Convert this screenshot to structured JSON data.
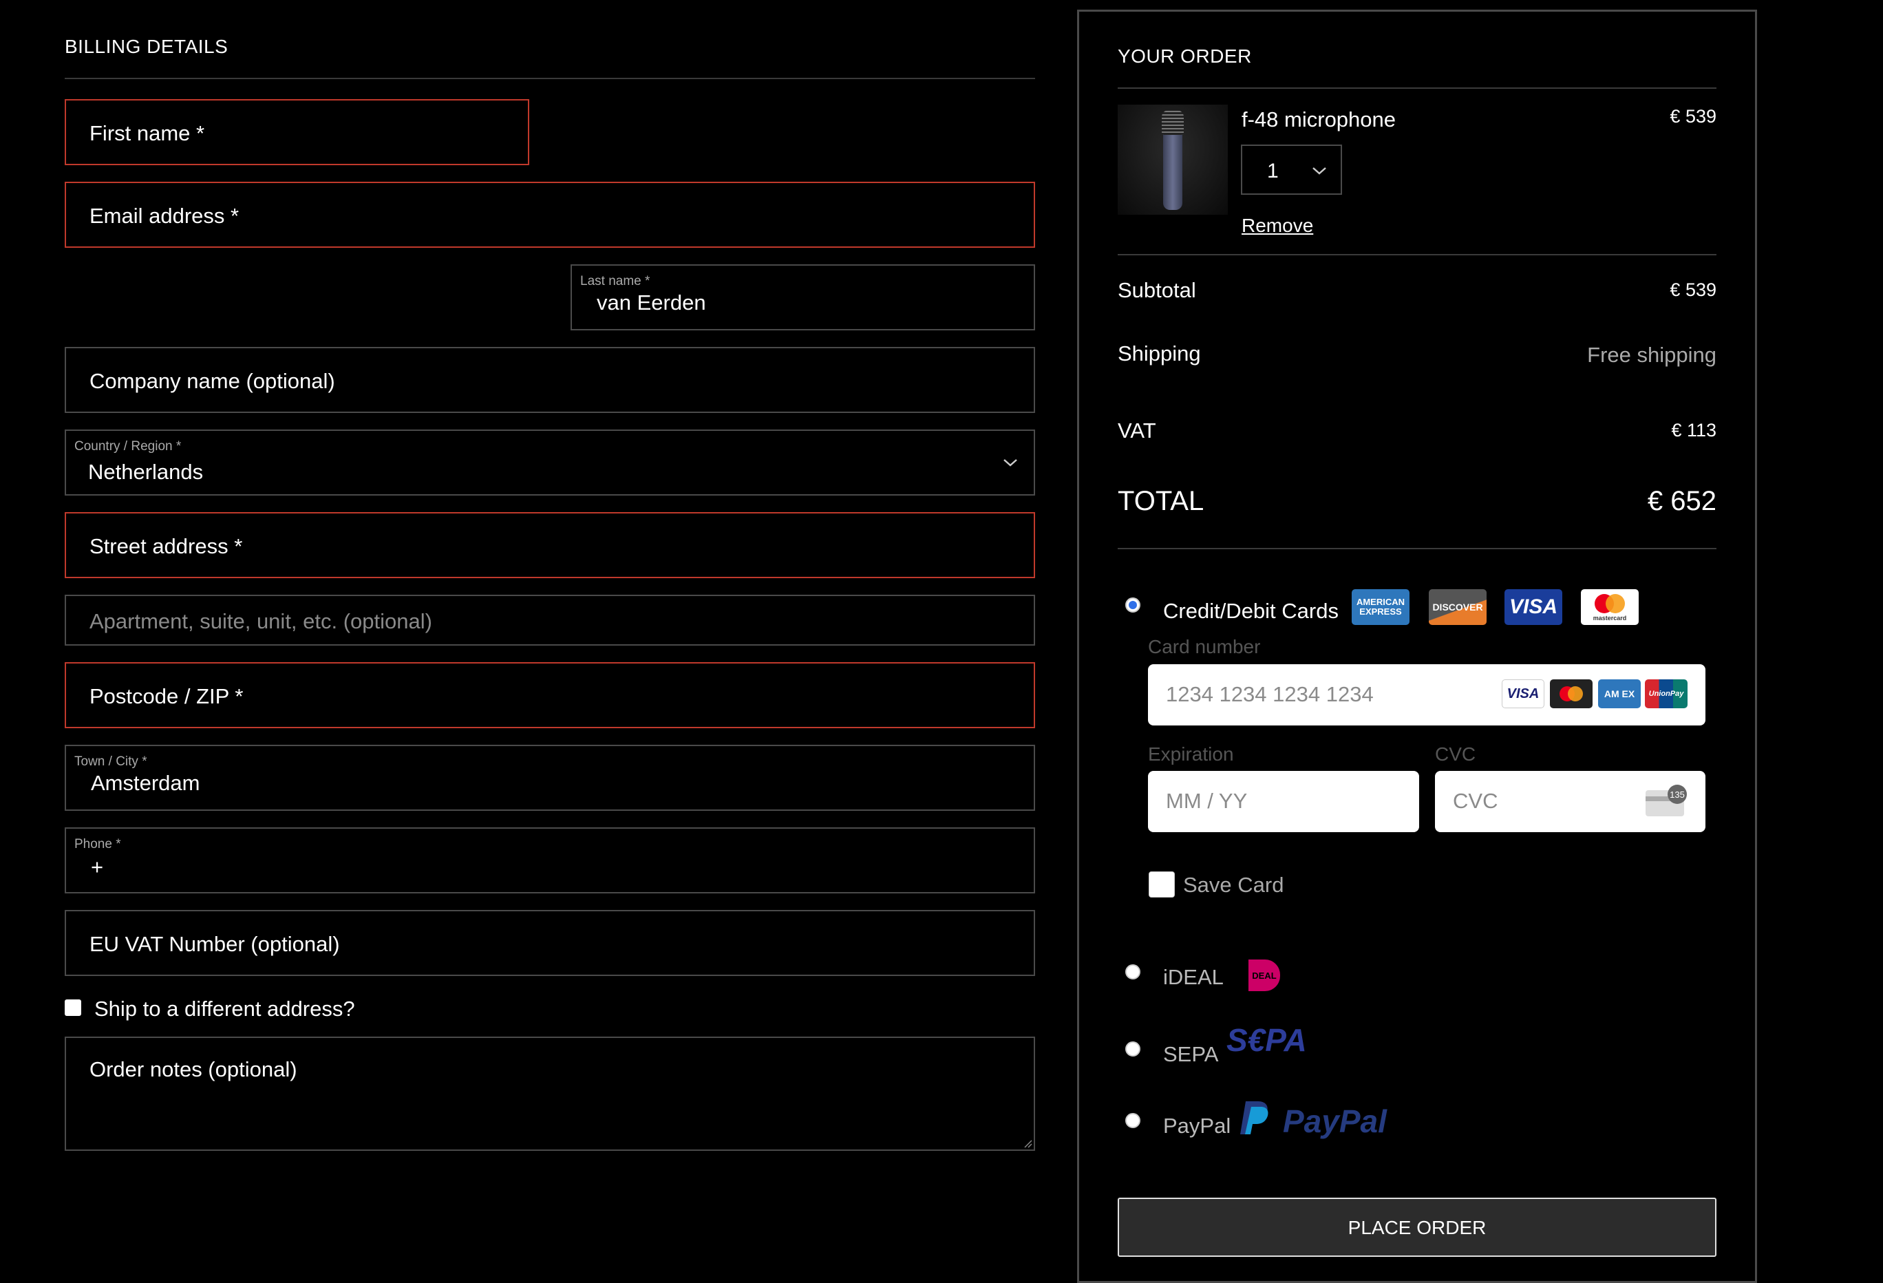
{
  "billing": {
    "heading": "BILLING DETAILS",
    "first_name": "First name *",
    "email": "Email address *",
    "last_name_label": "Last name *",
    "last_name_value": "van Eerden",
    "company": "Company name (optional)",
    "country_label": "Country / Region *",
    "country_value": "Netherlands",
    "street": "Street address *",
    "apartment": "Apartment, suite, unit, etc. (optional)",
    "postcode": "Postcode / ZIP *",
    "city_label": "Town / City *",
    "city_value": "Amsterdam",
    "phone_label": "Phone *",
    "phone_value": "+",
    "vat_number": "EU VAT Number (optional)",
    "ship_different": "Ship to a different address?",
    "order_notes": "Order notes (optional)"
  },
  "order": {
    "heading": "YOUR ORDER",
    "product_name": "f-48 microphone",
    "product_price": "€ 539",
    "quantity": "1",
    "remove": "Remove",
    "subtotal_label": "Subtotal",
    "subtotal_value": "€ 539",
    "shipping_label": "Shipping",
    "shipping_value": "Free shipping",
    "vat_label": "VAT",
    "vat_value": "€ 113",
    "total_label": "TOTAL",
    "total_value": "€ 652"
  },
  "payment": {
    "cards_label": "Credit/Debit Cards",
    "card_number_label": "Card number",
    "card_number_placeholder": "1234 1234 1234 1234",
    "expiration_label": "Expiration",
    "expiration_placeholder": "MM / YY",
    "cvc_label": "CVC",
    "cvc_placeholder": "CVC",
    "save_card": "Save Card",
    "ideal_label": "iDEAL",
    "sepa_label": "SEPA",
    "paypal_label": "PayPal",
    "place_order": "PLACE ORDER"
  },
  "logos": {
    "amex": "AMERICAN EXPRESS",
    "discover": "DISCOVER",
    "visa": "VISA",
    "mastercard": "mastercard",
    "amex_small": "AM EX",
    "unionpay": "UnionPay",
    "cvc_badge": "135",
    "ideal": "DEAL",
    "sepa": "S€PA",
    "paypal": "PayPal"
  },
  "colors": {
    "error_border": "#c0392b",
    "radio_selected": "#2f6fe8",
    "amex_blue": "#2e77bc",
    "visa_blue": "#1a1f71",
    "ideal_pink": "#cc0066",
    "sepa_blue": "#2d3d9b",
    "paypal_blue": "#253b80"
  }
}
